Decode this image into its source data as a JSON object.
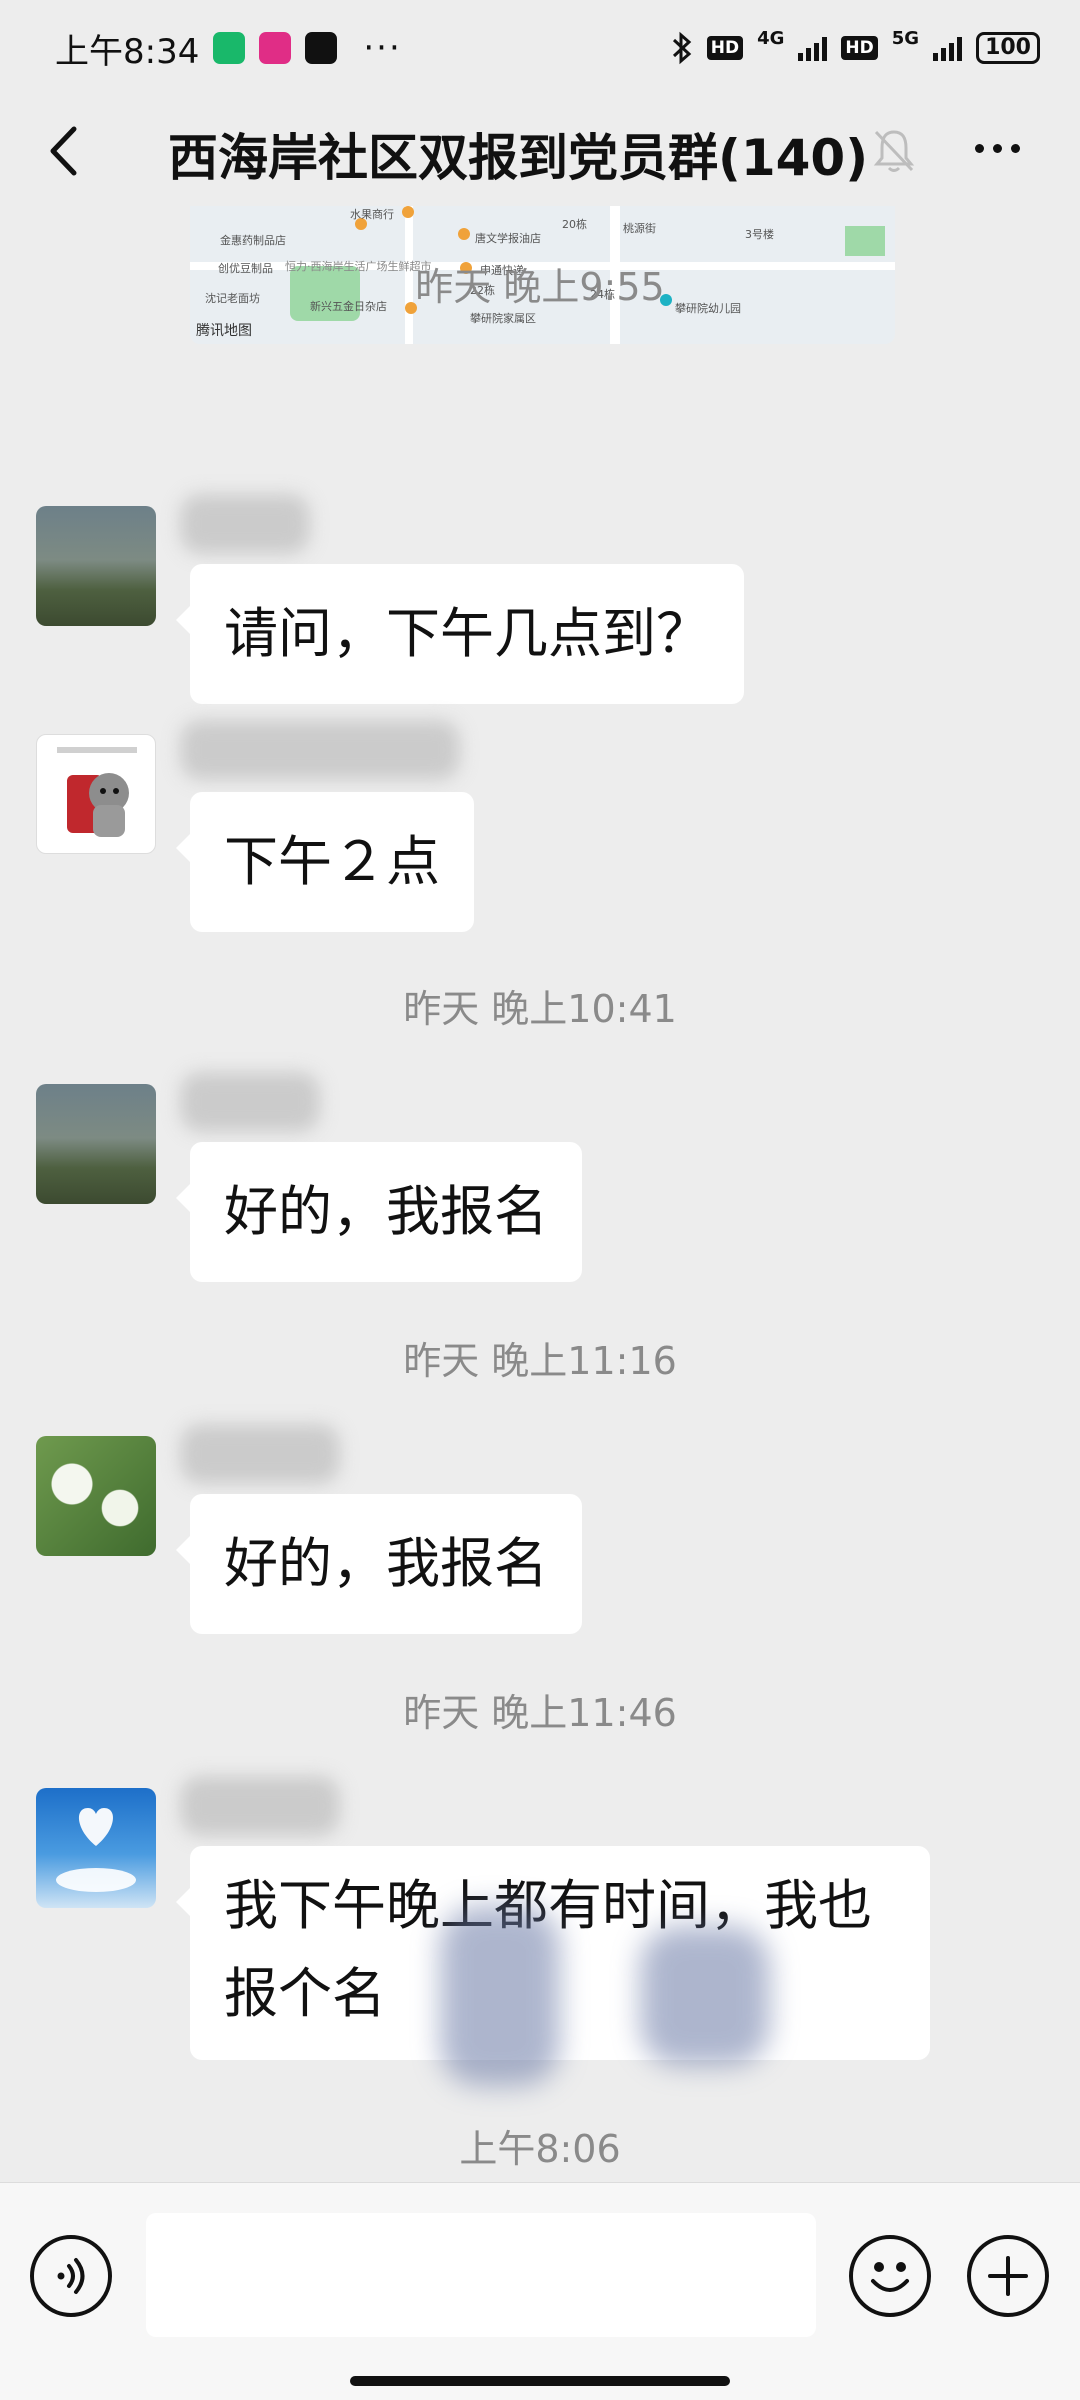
{
  "status_bar": {
    "time": "上午8:34",
    "dots": "···",
    "hd": "HD",
    "net1": "4G",
    "net2": "5G",
    "battery": "100"
  },
  "header": {
    "title": "西海岸社区双报到党员群(140)"
  },
  "map_card": {
    "labels": [
      "水果商行",
      "金惠药制品店",
      "唐文学报油店",
      "创优豆制品",
      "恒力·西海岸生活广场生鲜超市",
      "申通快递",
      "沈记老面坊",
      "新兴五金日杂店",
      "攀研院家属区",
      "攀研院幼儿园",
      "桃源街",
      "3号楼",
      "20栋",
      "22栋",
      "24栋"
    ],
    "logo": "腾讯地图"
  },
  "messages": [
    {
      "timestamp": "昨天 晚上9:55",
      "text": "请问，下午几点到？"
    },
    {
      "text": "下午２点"
    },
    {
      "timestamp": "昨天 晚上10:41",
      "text": "好的，我报名"
    },
    {
      "timestamp": "昨天 晚上11:16",
      "text": "好的，我报名"
    },
    {
      "timestamp": "昨天 晚上11:46",
      "text": "我下午晚上都有时间，我也报个名"
    }
  ],
  "last_timestamp": "上午8:06",
  "input": {
    "value": ""
  },
  "colors": {
    "background": "#ededed",
    "bubble": "#ffffff",
    "timestamp": "#8a8a8a"
  }
}
